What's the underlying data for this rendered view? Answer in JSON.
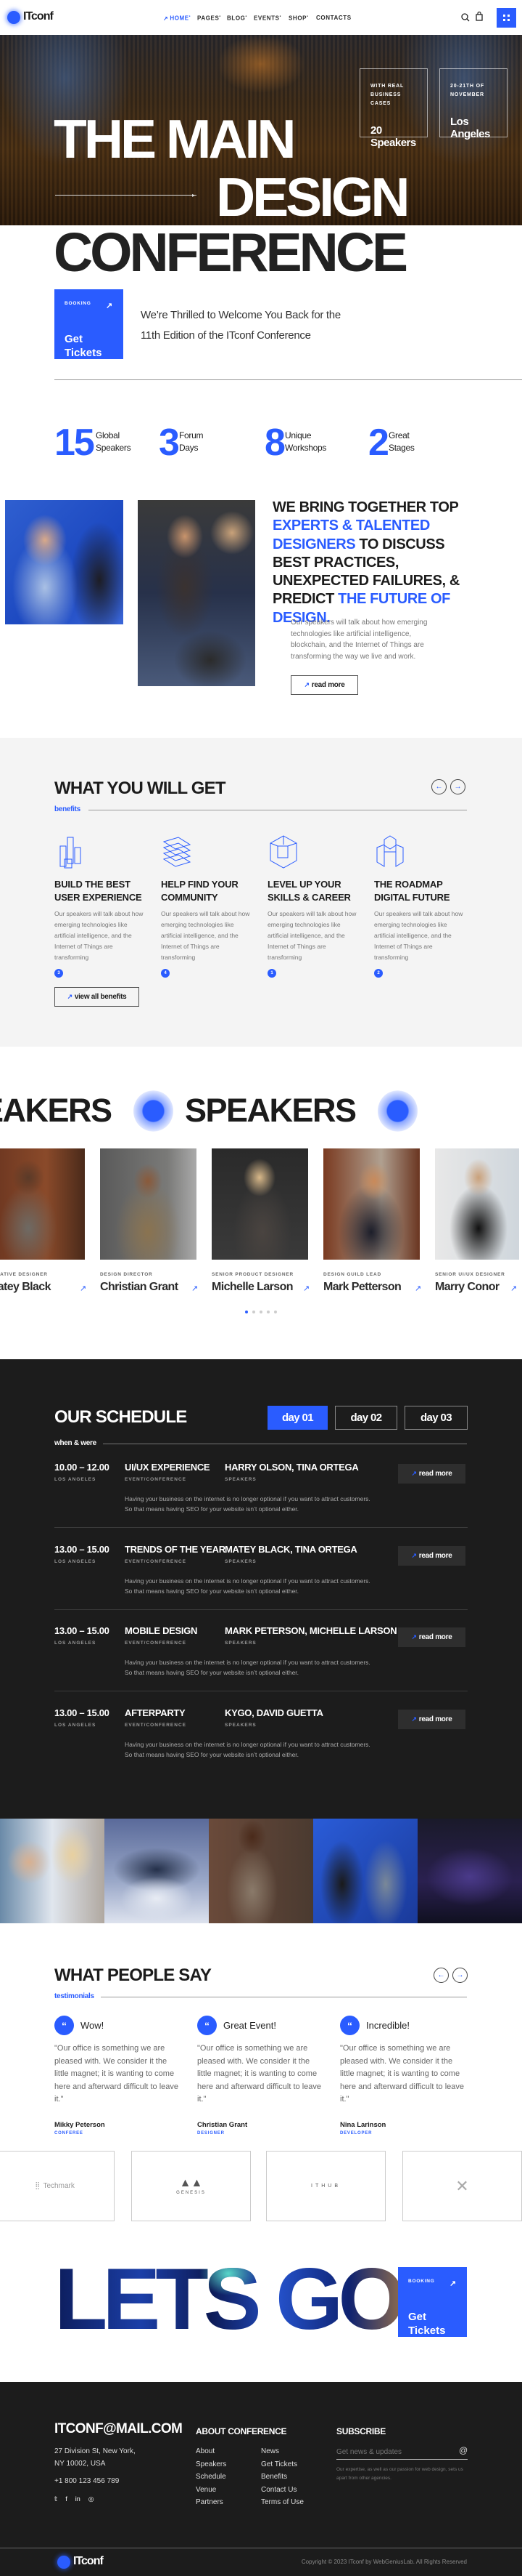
{
  "colors": {
    "accent": "#2a5cff",
    "dark": "#1c1c1c",
    "light_bg": "#f4f4f4"
  },
  "nav": {
    "logo": "ITconf",
    "items": [
      {
        "label": "HOME",
        "active": true,
        "dropdown": true
      },
      {
        "label": "PAGES",
        "dropdown": true
      },
      {
        "label": "BLOG",
        "dropdown": true
      },
      {
        "label": "EVENTS",
        "dropdown": true
      },
      {
        "label": "SHOP",
        "dropdown": true
      },
      {
        "label": "CONTACTS",
        "dropdown": false
      }
    ],
    "icons": [
      "search-icon",
      "cart-icon",
      "menu-grid-icon"
    ]
  },
  "hero": {
    "line1": "THE MAIN",
    "line2": "DESIGN",
    "line3": "CONFERENCE",
    "boxes": [
      {
        "small": "WITH REAL BUSINESS CASES",
        "big_1": "20",
        "big_2": "Speakers"
      },
      {
        "small": "20-21TH OF NOVEMBER",
        "big_1": "Los",
        "big_2": "Angeles"
      }
    ]
  },
  "booking": {
    "label": "BOOKING",
    "title_1": "Get",
    "title_2": "Tickets"
  },
  "intro": "We’re Thrilled to Welcome You Back for the 11th Edition of the ITconf Conference",
  "stats": [
    {
      "num": "15",
      "l1": "Global",
      "l2": "Speakers"
    },
    {
      "num": "3",
      "l1": "Forum",
      "l2": "Days"
    },
    {
      "num": "8",
      "l1": "Unique",
      "l2": "Workshops"
    },
    {
      "num": "2",
      "l1": "Great",
      "l2": "Stages"
    }
  ],
  "about": {
    "heading": [
      {
        "t": "WE BRING TOGETHER TOP ",
        "accent": false
      },
      {
        "t": "EXPERTS & TALENTED DESIGNERS",
        "accent": true
      },
      {
        "t": " TO DISCUSS BEST PRACTICES, UNEXPECTED FAILURES, & PREDICT ",
        "accent": false
      },
      {
        "t": "THE FUTURE OF DESIGN.",
        "accent": true
      }
    ],
    "text": "Our speakers will talk about how emerging technologies like artificial intelligence, blockchain, and the Internet of Things are transforming the way we live and work.",
    "button": "read more"
  },
  "benefits": {
    "title": "WHAT YOU WILL GET",
    "subtitle": "benefits",
    "button": "view all benefits",
    "items": [
      {
        "title_1": "BUILD THE BEST",
        "title_2": "USER EXPERIENCE",
        "text": "Our speakers will talk about how emerging technologies like artificial intelligence, and the Internet of Things are transforming",
        "num": "3",
        "icon": "isometric-towers-icon"
      },
      {
        "title_1": "HELP FIND YOUR",
        "title_2": "COMMUNITY",
        "text": "Our speakers will talk about how emerging technologies like artificial intelligence, and the Internet of Things are transforming",
        "num": "4",
        "icon": "isometric-bars-icon"
      },
      {
        "title_1": "LEVEL UP YOUR",
        "title_2": "SKILLS & CAREER",
        "text": "Our speakers will talk about how emerging technologies like artificial intelligence, and the Internet of Things are transforming",
        "num": "1",
        "icon": "isometric-maze-icon"
      },
      {
        "title_1": "THE ROADMAP",
        "title_2": "DIGITAL FUTURE",
        "text": "Our speakers will talk about how emerging technologies like artificial intelligence, and the Internet of Things are transforming",
        "num": "2",
        "icon": "isometric-cross-icon"
      }
    ]
  },
  "speakers": {
    "marquee": "SPEAKERS",
    "items": [
      {
        "role": "CREATIVE DESIGNER",
        "name": "Matey Black"
      },
      {
        "role": "DESIGN DIRECTOR",
        "name": "Christian Grant"
      },
      {
        "role": "SENIOR PRODUCT DESIGNER",
        "name": "Michelle Larson"
      },
      {
        "role": "DESIGN GUILD LEAD",
        "name": "Mark Petterson"
      },
      {
        "role": "SENIOR UI/UX DESIGNER",
        "name": "Marry Conor"
      }
    ],
    "pages": 5,
    "current_page": 1
  },
  "schedule": {
    "title": "OUR SCHEDULE",
    "subtitle": "when & were",
    "tabs": [
      {
        "label": "day 01",
        "active": true
      },
      {
        "label": "day 02"
      },
      {
        "label": "day 03"
      }
    ],
    "button": "read more",
    "rows": [
      {
        "time": "10.00 – 12.00",
        "place": "LOS ANGELES",
        "title": "UI/UX EXPERIENCE",
        "type": "EVENT/CONFERENCE",
        "speakers": "HARRY OLSON, TINA ORTEGA",
        "sp_label": "SPEAKERS",
        "desc": "Having your business on the internet is no longer optional if you want to attract customers. So that means having SEO for your website isn’t optional either."
      },
      {
        "time": "13.00 – 15.00",
        "place": "LOS ANGELES",
        "title": "TRENDS OF THE YEAR",
        "type": "EVENT/CONFERENCE",
        "speakers": "MATEY BLACK, TINA ORTEGA",
        "sp_label": "SPEAKERS",
        "desc": "Having your business on the internet is no longer optional if you want to attract customers. So that means having SEO for your website isn’t optional either."
      },
      {
        "time": "13.00 – 15.00",
        "place": "LOS ANGELES",
        "title": "MOBILE DESIGN",
        "type": "EVENT/CONFERENCE",
        "speakers": "MARK PETERSON, MICHELLE LARSON",
        "sp_label": "SPEAKERS",
        "desc": "Having your business on the internet is no longer optional if you want to attract customers. So that means having SEO for your website isn’t optional either."
      },
      {
        "time": "13.00 – 15.00",
        "place": "LOS ANGELES",
        "title": "AFTERPARTY",
        "type": "EVENT/CONFERENCE",
        "speakers": "KYGO, DAVID GUETTA",
        "sp_label": "SPEAKERS",
        "desc": "Having your business on the internet is no longer optional if you want to attract customers. So that means having SEO for your website isn’t optional either."
      }
    ]
  },
  "testimonials": {
    "title": "WHAT PEOPLE SAY",
    "subtitle": "testimonials",
    "items": [
      {
        "title": "Wow!",
        "text": "\"Our office is something we are pleased with. We consider it the little magnet; it is wanting to come here and afterward difficult to leave it.\"",
        "name": "Mikky Peterson",
        "role": "CONFEREE"
      },
      {
        "title": "Great Event!",
        "text": "\"Our office is something we are pleased with. We consider it the little magnet; it is wanting to come here and afterward difficult to leave it.\"",
        "name": "Christian Grant",
        "role": "DESIGNER"
      },
      {
        "title": "Incredible!",
        "text": "\"Our office is something we are pleased with. We consider it the little magnet; it is wanting to come here and afterward difficult to leave it.\"",
        "name": "Nina Larinson",
        "role": "DEVELOPER"
      }
    ]
  },
  "partners": [
    "Techmark",
    "GENESIS",
    "ITHUB",
    ""
  ],
  "cta": {
    "text": "LETS GO",
    "label": "BOOKING",
    "title_1": "Get",
    "title_2": "Tickets"
  },
  "footer": {
    "email": "ITCONF@MAIL.COM",
    "address_1": "27 Division St, New York,",
    "address_2": "NY 10002, USA",
    "phone": "+1 800 123 456 789",
    "social": [
      "twitter-icon",
      "facebook-icon",
      "linkedin-icon",
      "instagram-icon"
    ],
    "about_title": "ABOUT CONFERENCE",
    "links_1": [
      "About",
      "Speakers",
      "Schedule",
      "Venue",
      "Partners"
    ],
    "links_2": [
      "News",
      "Get Tickets",
      "Benefits",
      "Contact Us",
      "Terms of Use"
    ],
    "subscribe_title": "SUBSCRIBE",
    "subscribe_placeholder": "Get news & updates",
    "subscribe_text": "Our expertise, as well as our passion for web design, sets us apart from other agencies.",
    "logo": "ITconf",
    "copyright": "Copyright © 2023 ITconf by WebGeniusLab. All Rights Reserved"
  }
}
